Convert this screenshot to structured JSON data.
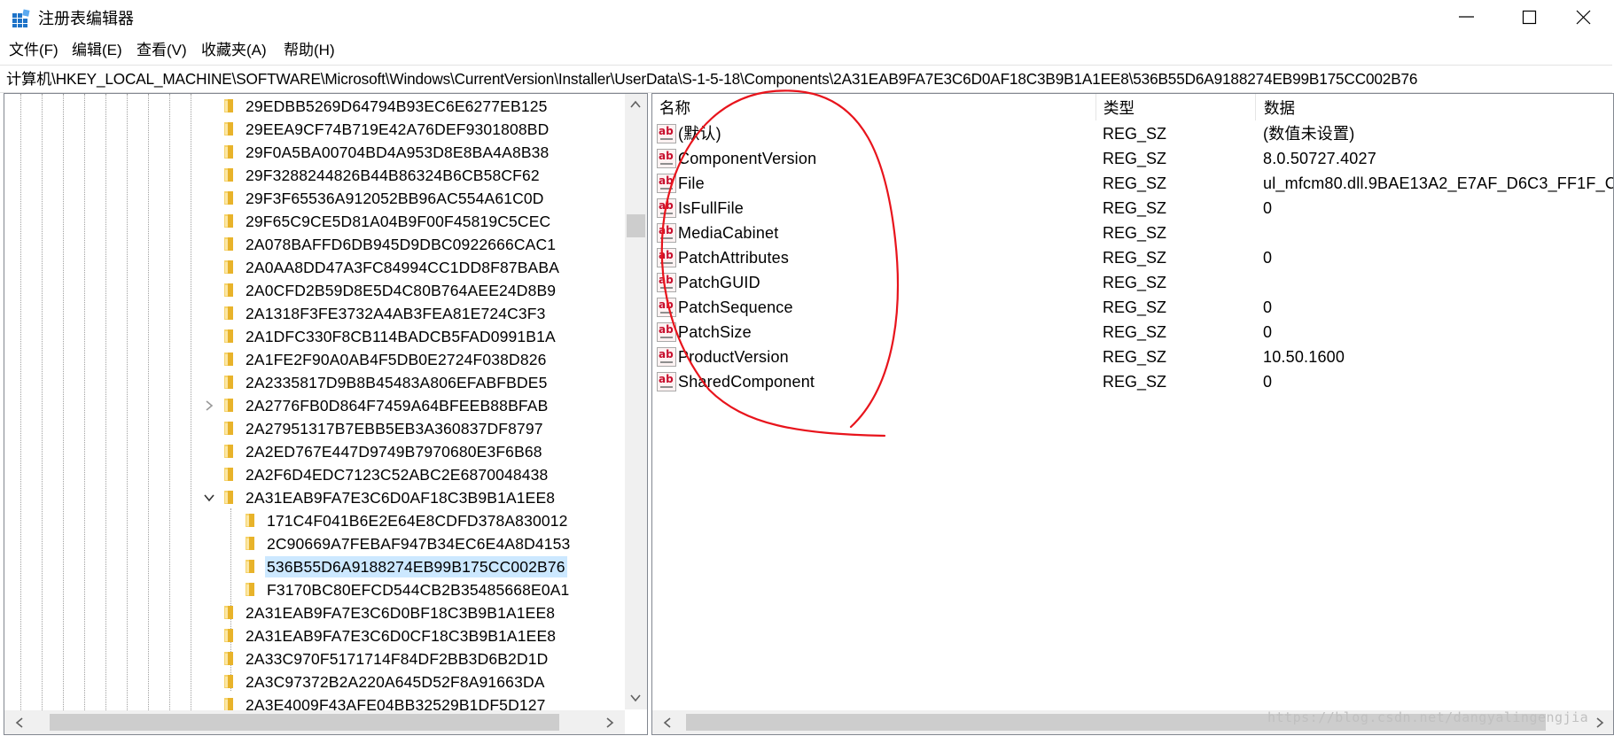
{
  "window": {
    "title": "注册表编辑器"
  },
  "menu": [
    "文件(F)",
    "编辑(E)",
    "查看(V)",
    "收藏夹(A)",
    "帮助(H)"
  ],
  "address": "计算机\\HKEY_LOCAL_MACHINE\\SOFTWARE\\Microsoft\\Windows\\CurrentVersion\\Installer\\UserData\\S-1-5-18\\Components\\2A31EAB9FA7E3C6D0AF18C3B9B1A1EE8\\536B55D6A9188274EB99B175CC002B76",
  "tree": {
    "items": [
      {
        "label": "29EDBB5269D64794B93EC6E6277EB125",
        "level": 0
      },
      {
        "label": "29EEA9CF74B719E42A76DEF9301808BD",
        "level": 0
      },
      {
        "label": "29F0A5BA00704BD4A953D8E8BA4A8B38",
        "level": 0
      },
      {
        "label": "29F3288244826B44B86324B6CB58CF62",
        "level": 0
      },
      {
        "label": "29F3F65536A912052BB96AC554A61C0D",
        "level": 0
      },
      {
        "label": "29F65C9CE5D81A04B9F00F45819C5CEC",
        "level": 0
      },
      {
        "label": "2A078BAFFD6DB945D9DBC0922666CAC1",
        "level": 0
      },
      {
        "label": "2A0AA8DD47A3FC84994CC1DD8F87BABA",
        "level": 0
      },
      {
        "label": "2A0CFD2B59D8E5D4C80B764AEE24D8B9",
        "level": 0
      },
      {
        "label": "2A1318F3FE3732A4AB3FEA81E724C3F3",
        "level": 0
      },
      {
        "label": "2A1DFC330F8CB114BADCB5FAD0991B1A",
        "level": 0
      },
      {
        "label": "2A1FE2F90A0AB4F5DB0E2724F038D826",
        "level": 0
      },
      {
        "label": "2A2335817D9B8B45483A806EFABFBDE5",
        "level": 0
      },
      {
        "label": "2A2776FB0D864F7459A64BFEEB88BFAB",
        "level": 0,
        "expander": "collapsed"
      },
      {
        "label": "2A27951317B7EBB5EB3A360837DF8797",
        "level": 0
      },
      {
        "label": "2A2ED767E447D9749B7970680E3F6B68",
        "level": 0
      },
      {
        "label": "2A2F6D4EDC7123C52ABC2E6870048438",
        "level": 0
      },
      {
        "label": "2A31EAB9FA7E3C6D0AF18C3B9B1A1EE8",
        "level": 0,
        "expander": "expanded"
      },
      {
        "label": "171C4F041B6E2E64E8CDFD378A830012",
        "level": 1
      },
      {
        "label": "2C90669A7FEBAF947B34EC6E4A8D4153",
        "level": 1
      },
      {
        "label": "536B55D6A9188274EB99B175CC002B76",
        "level": 1,
        "selected": true
      },
      {
        "label": "F3170BC80EFCD544CB2B35485668E0A1",
        "level": 1
      },
      {
        "label": "2A31EAB9FA7E3C6D0BF18C3B9B1A1EE8",
        "level": 0
      },
      {
        "label": "2A31EAB9FA7E3C6D0CF18C3B9B1A1EE8",
        "level": 0
      },
      {
        "label": "2A33C970F5171714F84DF2BB3D6B2D1D",
        "level": 0
      },
      {
        "label": "2A3C97372B2A220A645D52F8A91663DA",
        "level": 0
      },
      {
        "label": "2A3E4009F43AFE04BB32529B1DF5D127",
        "level": 0
      }
    ]
  },
  "values": {
    "headers": {
      "name": "名称",
      "type": "类型",
      "data": "数据"
    },
    "rows": [
      {
        "name": "(默认)",
        "type": "REG_SZ",
        "data": "(数值未设置)"
      },
      {
        "name": "ComponentVersion",
        "type": "REG_SZ",
        "data": "8.0.50727.4027"
      },
      {
        "name": "File",
        "type": "REG_SZ",
        "data": "ul_mfcm80.dll.9BAE13A2_E7AF_D6C3_FF1F_C"
      },
      {
        "name": "IsFullFile",
        "type": "REG_SZ",
        "data": "0"
      },
      {
        "name": "MediaCabinet",
        "type": "REG_SZ",
        "data": ""
      },
      {
        "name": "PatchAttributes",
        "type": "REG_SZ",
        "data": "0"
      },
      {
        "name": "PatchGUID",
        "type": "REG_SZ",
        "data": ""
      },
      {
        "name": "PatchSequence",
        "type": "REG_SZ",
        "data": "0"
      },
      {
        "name": "PatchSize",
        "type": "REG_SZ",
        "data": "0"
      },
      {
        "name": "ProductVersion",
        "type": "REG_SZ",
        "data": "10.50.1600"
      },
      {
        "name": "SharedComponent",
        "type": "REG_SZ",
        "data": "0"
      }
    ]
  },
  "icons": {
    "value_icon": "ab",
    "folder_color": "#e8b32a",
    "annotation_color": "#e8141c"
  },
  "watermark": "https://blog.csdn.net/dangyalingengjia"
}
